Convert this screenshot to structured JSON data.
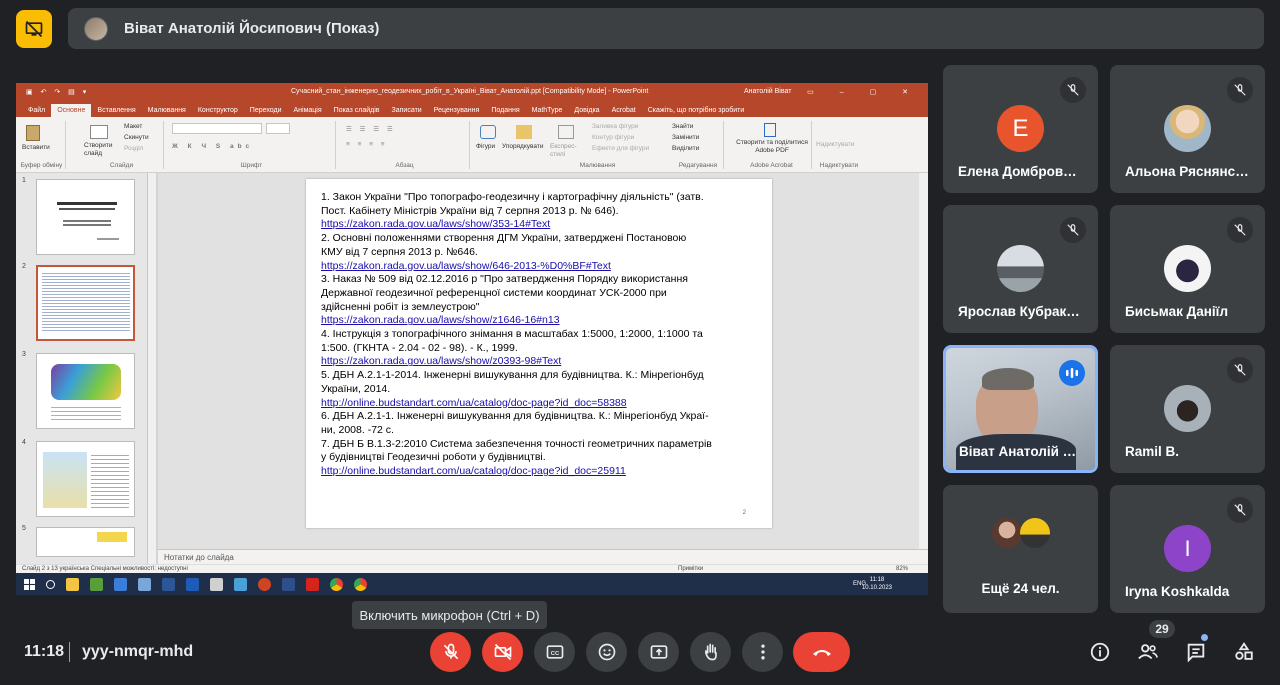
{
  "header": {
    "presenter_label": "Віват Анатолій Йосипович (Показ)"
  },
  "ppt": {
    "title": "Сучасний_стан_інженерно_геодезичних_робіт_в_Україні_Віват_Анатолій.ppt [Compatibility Mode] - PowerPoint",
    "user": "Анатолій Віват",
    "tabs": [
      "Файл",
      "Основне",
      "Вставлення",
      "Малювання",
      "Конструктор",
      "Переходи",
      "Анімація",
      "Показ слайдів",
      "Записати",
      "Рецензування",
      "Подання",
      "MathType",
      "Довідка",
      "Acrobat",
      "Скажіть, що потрібно зробити"
    ],
    "ribbon": {
      "paste": "Вставити",
      "clipboard": "Буфер обміну",
      "new_slide": "Створити слайд",
      "layout": "Макет",
      "reset": "Скинути",
      "section": "Розділ",
      "slides": "Слайди",
      "font": "Шрифт",
      "paragraph": "Абзац",
      "shapes": "Фігури",
      "arrange": "Упорядкувати",
      "quick_styles": "Експрес-стилі",
      "fill": "Заливка фігури",
      "outline": "Контур фігури",
      "effects": "Ефекти для фігури",
      "drawing": "Малювання",
      "find": "Знайти",
      "replace": "Замінити",
      "select": "Виділити",
      "editing": "Редагування",
      "acrobat": "Створити та поділитися Adobe PDF",
      "adobe_acrobat": "Adobe Acrobat",
      "dictate": "Надиктувати",
      "voice": "Надиктувати"
    },
    "thumbs": [
      "1",
      "2",
      "3",
      "4",
      "5"
    ],
    "slide_lines": [
      {
        "text": "1. Закон  України \"Про топографо-геодезичну і картографічну діяльність\" (затв.",
        "link": false
      },
      {
        "text": "Пост.      Кабінету Міністрів України від 7 серпня 2013 р. № 646).",
        "link": false
      },
      {
        "text": "https://zakon.rada.gov.ua/laws/show/353-14#Text",
        "link": true
      },
      {
        "text": "2. Основні  положеннями  створення ДГМ України, затверджені Постановою",
        "link": false
      },
      {
        "text": "КМУ від 7 серпня 2013 р. №646.",
        "link": false
      },
      {
        "text": "https://zakon.rada.gov.ua/laws/show/646-2013-%D0%BF#Text",
        "link": true
      },
      {
        "text": "3. Наказ № 509 від 02.12.2016 р \"Про затвердження Порядку використання",
        "link": false
      },
      {
        "text": "Державної геодезичної референцної системи координат УСК-2000 при",
        "link": false
      },
      {
        "text": "здійсненні робіт із землеустрою\"",
        "link": false
      },
      {
        "text": "https://zakon.rada.gov.ua/laws/show/z1646-16#n13",
        "link": true
      },
      {
        "text": "4. Інструкція з топографічного знімання в масштабах 1:5000, 1:2000, 1:1000 та",
        "link": false
      },
      {
        "text": "1:500. (ГКНТА - 2.04 - 02 - 98). - К., 1999.",
        "link": false
      },
      {
        "text": "https://zakon.rada.gov.ua/laws/show/z0393-98#Text",
        "link": true
      },
      {
        "text": "5. ДБН А.2.1-1-2014. Інженерні вишукування для будівництва. К.: Мінрегіонбуд",
        "link": false
      },
      {
        "text": "України, 2014.",
        "link": false
      },
      {
        "text": "http://online.budstandart.com/ua/catalog/doc-page?id_doc=58388",
        "link": true
      },
      {
        "text": "6. ДБН А.2.1-1. Інженерні вишукування для будівництва. К.: Мінрегіонбуд Украї-",
        "link": false
      },
      {
        "text": "ни, 2008. -72 с.",
        "link": false
      },
      {
        "text": "7. ДБН Б В.1.3-2:2010 Система забезпечення точності геометричних параметрів",
        "link": false
      },
      {
        "text": "у будівництві Геодезичні роботи у будівництві.",
        "link": false
      },
      {
        "text": "http://online.budstandart.com/ua/catalog/doc-page?id_doc=25911",
        "link": true
      }
    ],
    "slide_number": "2",
    "notes": "Нотатки до слайда",
    "status": "Слайд 2 з 13    українська    Спеціальні можливості: недоступні",
    "status_right": "Примітки",
    "zoom": "82%",
    "taskbar_time": "11:18",
    "taskbar_date": "10.10.2023",
    "taskbar_lang": "ENG"
  },
  "participants": [
    {
      "name": "Елена Домбров…",
      "initial": "E",
      "color": "#e8542c"
    },
    {
      "name": "Альона Ряснянс…",
      "initial": "",
      "color": "#9fb7c8"
    },
    {
      "name": "Ярослав Кубрак…",
      "initial": "",
      "color": "#7b8a95"
    },
    {
      "name": "Бисьмак Даніїл",
      "initial": "",
      "color": "#f0f0f0"
    },
    {
      "name": "Віват Анатолій …",
      "initial": "",
      "color": ""
    },
    {
      "name": "Ramil B.",
      "initial": "",
      "color": "#a9b1b8"
    },
    {
      "name": "Ещё 24 чел.",
      "initial": "",
      "color": ""
    },
    {
      "name": "Iryna Koshkalda",
      "initial": "I",
      "color": "#8e44c8"
    }
  ],
  "tooltip": "Включить микрофон (Ctrl + D)",
  "footer": {
    "time": "11:18",
    "meeting_code": "yyy-nmqr-mhd",
    "participant_count": "29"
  },
  "icons": {
    "present": "presenting-off-icon",
    "mic": "mic-off-icon",
    "cam": "videocam-off-icon",
    "cc": "closed-caption-icon",
    "emoji": "emoji-icon",
    "share": "present-screen-icon",
    "hand": "raise-hand-icon",
    "more": "more-vert-icon",
    "end": "call-end-icon",
    "info": "info-icon",
    "people": "people-icon",
    "chat": "chat-icon",
    "activities": "activities-icon"
  },
  "colors": {
    "present_badge": "#fbbc04",
    "end_call": "#ea4335",
    "accent_blue": "#8ab4f8",
    "ppt_red": "#b7472a"
  }
}
